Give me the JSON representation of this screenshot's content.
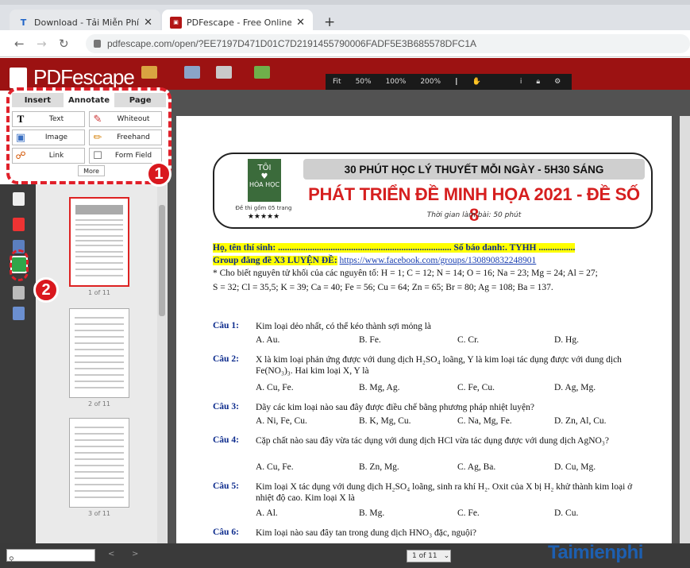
{
  "browser": {
    "tabs": [
      {
        "title": "Download - Tải Miễn Phí VN - Ph",
        "icon": "T"
      },
      {
        "title": "PDFescape - Free Online PDF Edi",
        "icon": "pdf"
      }
    ],
    "new_tab": "+",
    "url": "pdfescape.com/open/?EE7197D471D01C7D2191455790006FADF5E3B685578DFC1A"
  },
  "app": {
    "logo": "PDFescape",
    "zoom_options": [
      "Fit",
      "50%",
      "100%",
      "200%"
    ],
    "page_label": "Page"
  },
  "tool_panel": {
    "tabs": [
      "Insert",
      "Annotate",
      "Page"
    ],
    "tools": [
      {
        "label": "Text",
        "icon": "text-tool-icon"
      },
      {
        "label": "Whiteout",
        "icon": "whiteout-icon"
      },
      {
        "label": "Image",
        "icon": "image-icon"
      },
      {
        "label": "Freehand",
        "icon": "pencil-icon"
      },
      {
        "label": "Link",
        "icon": "link-icon"
      },
      {
        "label": "Form Field",
        "icon": "form-field-icon"
      }
    ],
    "more": "More"
  },
  "badges": [
    "1",
    "2"
  ],
  "thumbnails": [
    "1 of 11",
    "2 of 11",
    "3 of 11"
  ],
  "document": {
    "box_band": "30 PHÚT HỌC LÝ THUYẾT MỖI NGÀY - 5H30 SÁNG",
    "box_title": "PHÁT TRIỂN ĐỀ MINH HỌA 2021 - ĐỀ SỐ 8",
    "box_sub": "Thời gian làm bài: 50 phút",
    "logo_top": "TÔI",
    "logo_heart": "♥",
    "logo_bottom": "HÓA HỌC",
    "logo_pages": "Đề thi gồm 05 trang",
    "logo_stars": "★★★★★",
    "name_line": "Họ, tên thí sinh: ............................................................................ Số báo danh:. TYHH ................",
    "group_label": "Group đăng đề X3 LUYỆN ĐỀ:",
    "group_url": "https://www.facebook.com/groups/130890832248901",
    "note1": "* Cho biết nguyên tử khối của các nguyên tố: H = 1; C = 12; N = 14; O = 16; Na = 23; Mg = 24; Al = 27;",
    "note2": "S = 32; Cl = 35,5; K = 39; Ca = 40; Fe = 56; Cu = 64; Zn = 65; Br = 80; Ag = 108; Ba = 137.",
    "questions": [
      {
        "num": "Câu 1:",
        "text": "Kim loại dẻo nhất, có thể kéo thành sợi mỏng là",
        "opts": [
          "A. Au.",
          "B. Fe.",
          "C. Cr.",
          "D. Hg."
        ]
      },
      {
        "num": "Câu 2:",
        "text": "X là kim loại phản ứng được với dung dịch H₂SO₄ loãng, Y là kim loại tác dụng được với dung dịch Fe(NO₃)₃. Hai kim loại X, Y là",
        "opts": [
          "A. Cu, Fe.",
          "B. Mg, Ag.",
          "C. Fe, Cu.",
          "D. Ag, Mg."
        ]
      },
      {
        "num": "Câu 3:",
        "text": "Dãy các kim loại nào sau đây được điều chế bằng phương pháp nhiệt luyện?",
        "opts": [
          "A. Ni, Fe, Cu.",
          "B. K, Mg, Cu.",
          "C. Na, Mg, Fe.",
          "D. Zn, Al, Cu."
        ]
      },
      {
        "num": "Câu 4:",
        "text": "Cặp chất nào sau đây vừa tác dụng với dung dịch HCl vừa tác dụng được với dung dịch AgNO₃?",
        "opts": [
          "A. Cu, Fe.",
          "B. Zn, Mg.",
          "C. Ag, Ba.",
          "D. Cu, Mg."
        ]
      },
      {
        "num": "Câu 5:",
        "text": "Kim loại X tác dụng với dung dịch H₂SO₄ loãng, sinh ra khí H₂. Oxit của X bị H₂ khử thành kim loại ở nhiệt độ cao. Kim loại X là",
        "opts": [
          "A. Al.",
          "B. Mg.",
          "C. Fe.",
          "D. Cu."
        ]
      },
      {
        "num": "Câu 6:",
        "text": "Kim loại nào sau đây tan trong dung dịch HNO₃ đặc, nguội?",
        "opts": []
      }
    ]
  },
  "status": {
    "page_select": "1 of 11",
    "prev": "<",
    "next": ">"
  },
  "watermark": "Taimienphi"
}
